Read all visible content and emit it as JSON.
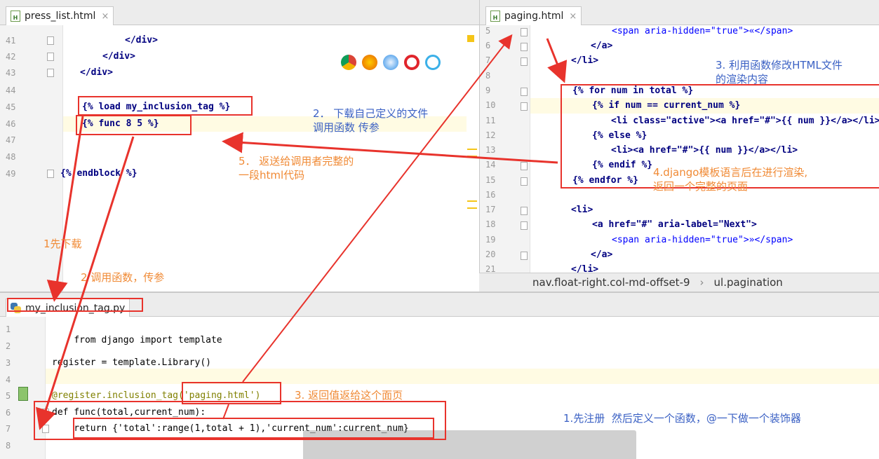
{
  "left_editor": {
    "tab_label": "press_list.html",
    "close_symbol": "×",
    "line_numbers": [
      "41",
      "42",
      "43",
      "44",
      "45",
      "46",
      "47",
      "48",
      "49"
    ],
    "lines": [
      "</div>",
      "</div>",
      "</div>",
      "",
      "{% load my_inclusion_tag %}",
      "{% func 8 5 %}",
      "",
      "",
      "{% endblock %}"
    ]
  },
  "right_editor": {
    "tab_label": "paging.html",
    "close_symbol": "×",
    "line_numbers": [
      "5",
      "6",
      "7",
      "8",
      "9",
      "10",
      "11",
      "12",
      "13",
      "14",
      "15",
      "16",
      "17",
      "18",
      "19",
      "20",
      "21"
    ],
    "lines": [
      "<span aria-hidden=\"true\">«</span>",
      "</a>",
      "</li>",
      "",
      "{% for num in total %}",
      "{% if num == current_num %}",
      "<li class=\"active\"><a href=\"#\">{{ num }}</a></li>",
      "{% else %}",
      "<li><a href=\"#\">{{ num }}</a></li>",
      "{% endif %}",
      "{% endfor %}",
      "",
      "<li>",
      "<a href=\"#\" aria-label=\"Next\">",
      "<span aria-hidden=\"true\">»</span>",
      "</a>",
      "</li>"
    ],
    "breadcrumb": [
      "nav.float-right.col-md-offset-9",
      "ul.pagination"
    ],
    "breadcrumb_sep": "›"
  },
  "bottom_editor": {
    "tab_label": "my_inclusion_tag.py",
    "line_numbers": [
      "1",
      "2",
      "3",
      "4",
      "5",
      "6",
      "7",
      "8"
    ],
    "lines": [
      "from django import template",
      "",
      "register = template.Library()",
      "",
      "@register.inclusion_tag('paging.html')",
      "def func(total,current_num):",
      "    return {'total':range(1,total + 1),'current_num':current_num}",
      ""
    ]
  },
  "annotations": {
    "step1_download": "1先下载",
    "step2_call": "2 调用函数，传参",
    "step2_download": "2． 下载自己定义的文件\n调用函数 传参",
    "step3_modify": "3. 利用函数修改HTML文件\n的渲染内容",
    "step3_return": "3. 返回值返给这个面页",
    "step4_render": "4.django模板语言后在进行渲染,\n返回一个完整的页面",
    "step5_return": "5． 返送给调用者完整的\n一段html代码",
    "step1_register": "1.先注册  然后定义一个函数，@一下做一个装饰器"
  },
  "colors": {
    "annotation_orange": "#f08a35",
    "annotation_blue": "#3b61c4",
    "arrow_red": "#e8332c"
  }
}
